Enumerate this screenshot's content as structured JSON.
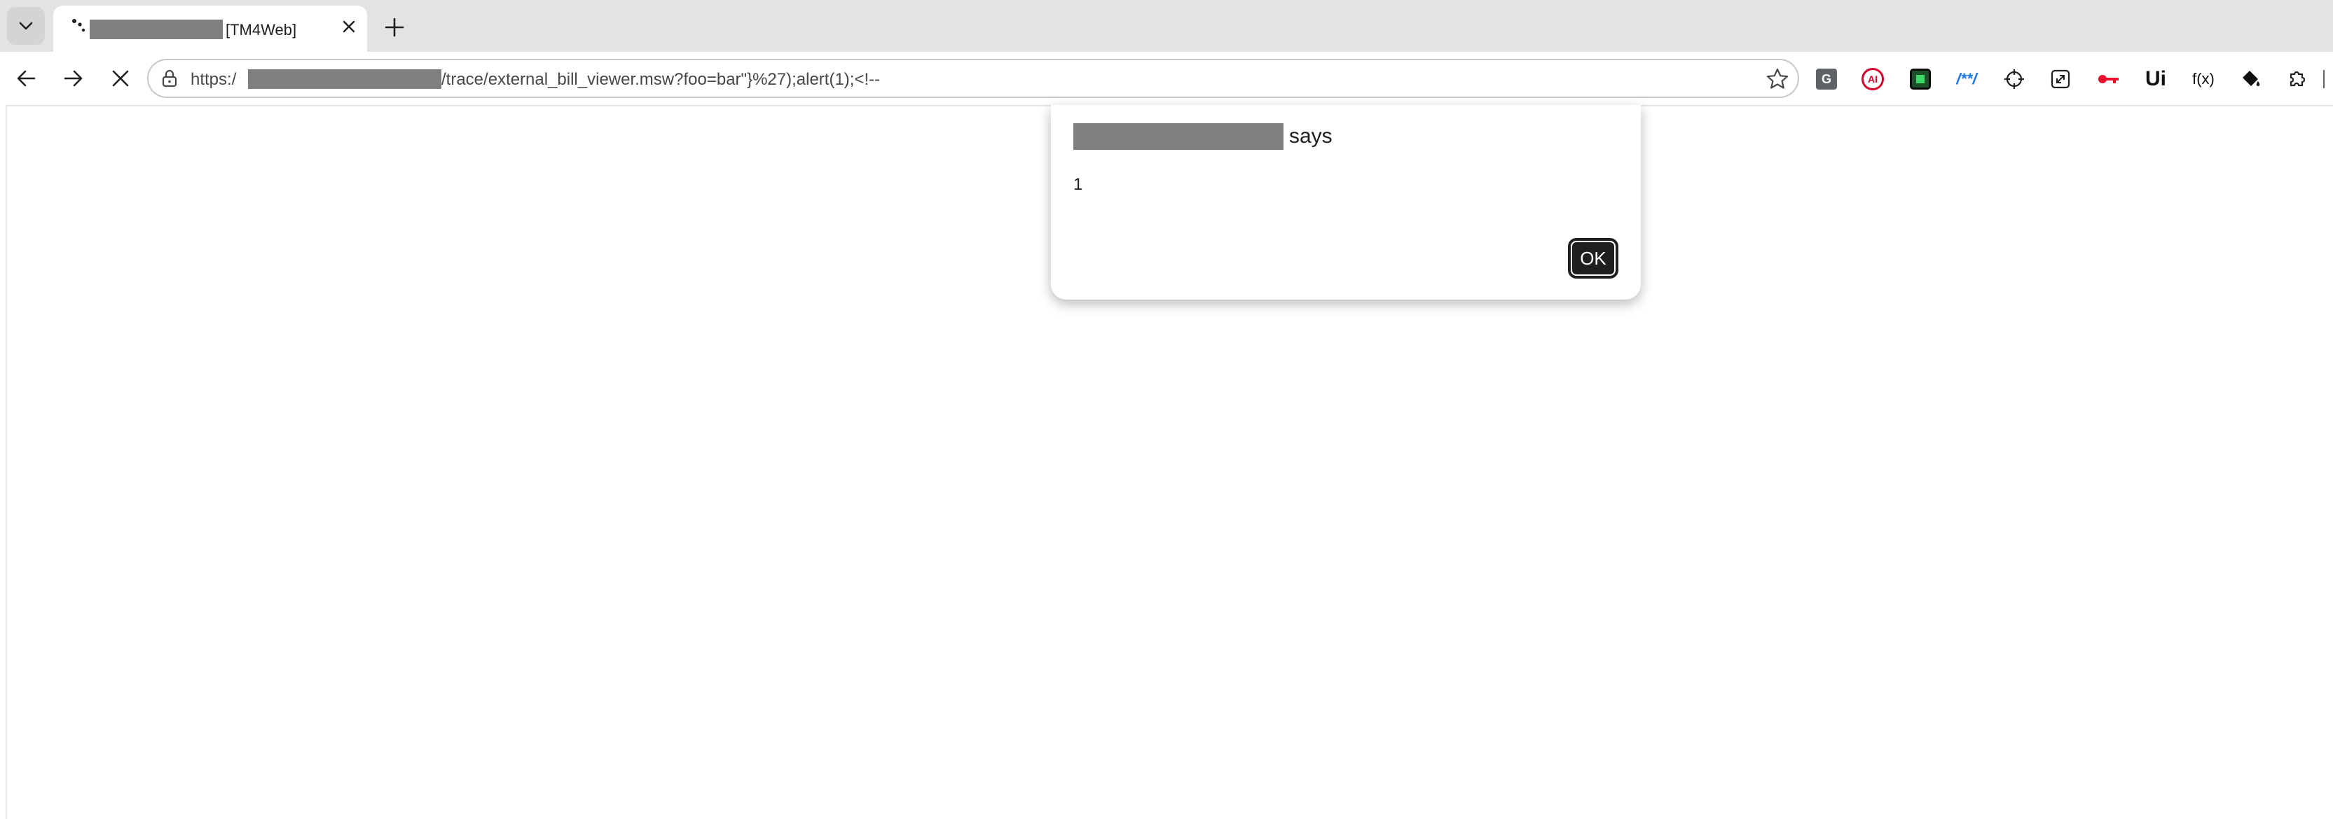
{
  "tab": {
    "title": "[TM4Web]",
    "close_icon": "close-icon",
    "new_tab_icon": "plus-icon"
  },
  "toolbar": {
    "url_prefix": "https:/",
    "url_suffix": "/trace/external_bill_viewer.msw?foo=bar\"}%27);alert(1);<!--"
  },
  "extensions": [
    {
      "name": "g-extension-icon",
      "label": "G"
    },
    {
      "name": "ai-extension-icon",
      "label": "AI"
    },
    {
      "name": "green-square-extension-icon",
      "label": ""
    },
    {
      "name": "regex-extension-icon",
      "label": "/**/"
    },
    {
      "name": "crosshair-extension-icon",
      "label": ""
    },
    {
      "name": "resize-extension-icon",
      "label": ""
    },
    {
      "name": "key-extension-icon",
      "label": ""
    },
    {
      "name": "unicode-extension-icon",
      "label": "Ui"
    },
    {
      "name": "function-extension-icon",
      "label": "f(x)"
    },
    {
      "name": "paint-bucket-extension-icon",
      "label": ""
    },
    {
      "name": "puzzle-extensions-icon",
      "label": ""
    }
  ],
  "dialog": {
    "says": "says",
    "message": "1",
    "ok_label": "OK"
  },
  "colors": {
    "tabstrip": "#e3e3e3",
    "redaction": "#808080",
    "ok_button": "#1f1f1f"
  }
}
